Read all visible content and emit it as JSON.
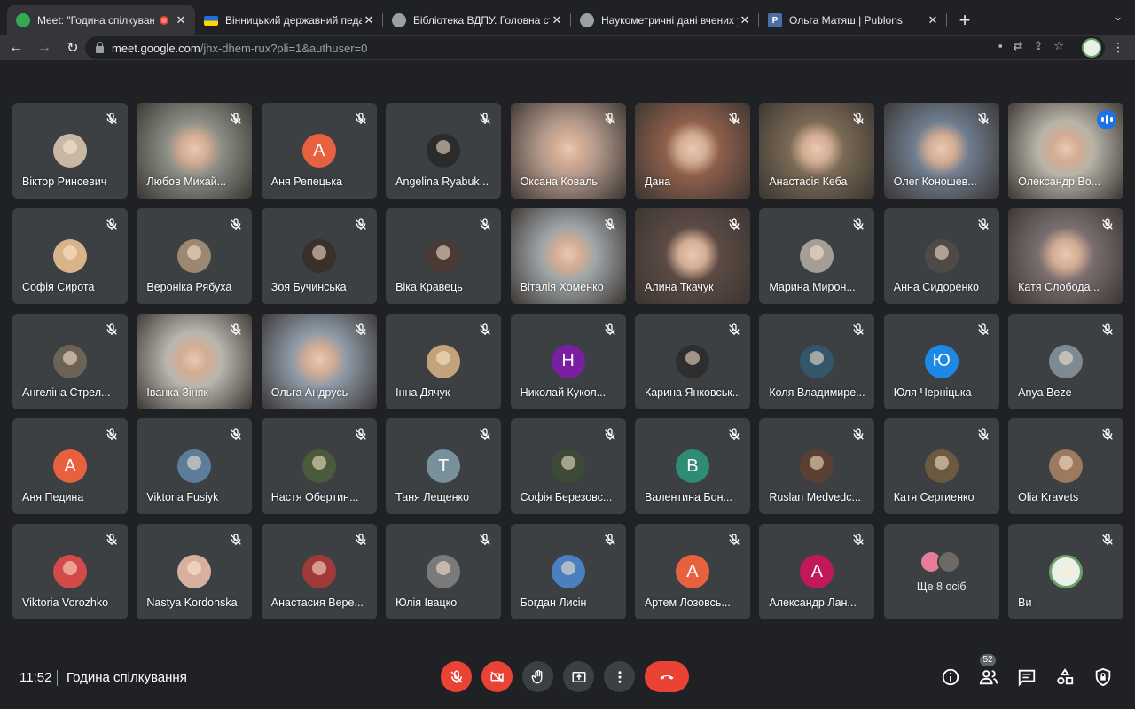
{
  "browser": {
    "tabs": [
      {
        "title": "Meet: \"Година спілкуванн",
        "favicon": "meet-icon",
        "fav_color": "#34a853",
        "recording": true,
        "active": true
      },
      {
        "title": "Вінницький державний педаг",
        "favicon": "ukraine-flag-icon",
        "fav_color": "#ffd500",
        "active": false
      },
      {
        "title": "Бібліотека ВДПУ. Головна сто",
        "favicon": "globe-icon",
        "fav_color": "#9aa0a6",
        "active": false
      },
      {
        "title": "Наукометричні дані вчених у",
        "favicon": "globe-icon",
        "fav_color": "#9aa0a6",
        "active": false
      },
      {
        "title": "Ольга Матяш | Publons",
        "favicon": "publons-icon",
        "fav_color": "#4a6fa5",
        "fav_letter": "P",
        "active": false
      }
    ],
    "url_host": "meet.google.com",
    "url_path": "/jhx-dhem-rux?pli=1&authuser=0"
  },
  "participants": [
    {
      "name": "Віктор Ринсевич",
      "type": "avatar_photo",
      "color": "#c9b7a6"
    },
    {
      "name": "Любов Михай...",
      "type": "video",
      "color": "#8c8f86"
    },
    {
      "name": "Аня Репецька",
      "type": "avatar_letter",
      "letter": "А",
      "color": "#e8613f"
    },
    {
      "name": "Angelina Ryabuk...",
      "type": "avatar_photo",
      "color": "#2b2b2b"
    },
    {
      "name": "Оксана Коваль",
      "type": "video",
      "color": "#b59a8c"
    },
    {
      "name": "Дана",
      "type": "video",
      "color": "#8e5f4b"
    },
    {
      "name": "Анастасія Кеба",
      "type": "video",
      "color": "#7a6a55"
    },
    {
      "name": "Олег Коношев...",
      "type": "video",
      "color": "#6f7d8f"
    },
    {
      "name": "Олександр Во...",
      "type": "video",
      "color": "#b8b4a8",
      "speaking": true
    },
    {
      "name": "Софія Сирота",
      "type": "avatar_photo",
      "color": "#d9b48b"
    },
    {
      "name": "Вероніка Рябуха",
      "type": "avatar_photo",
      "color": "#9b8872"
    },
    {
      "name": "Зоя Бучинська",
      "type": "avatar_photo",
      "color": "#3a2f2a"
    },
    {
      "name": "Віка Кравець",
      "type": "avatar_photo",
      "color": "#4a3a35"
    },
    {
      "name": "Віталія Хоменко",
      "type": "video",
      "color": "#9fa5a8"
    },
    {
      "name": "Алина Ткачук",
      "type": "video",
      "color": "#5c4a44"
    },
    {
      "name": "Марина Мирон...",
      "type": "avatar_photo",
      "color": "#a49e97"
    },
    {
      "name": "Анна Сидоренко",
      "type": "avatar_photo",
      "color": "#4f4a48"
    },
    {
      "name": "Катя Слобода...",
      "type": "video",
      "color": "#7a6e70"
    },
    {
      "name": "Ангеліна Стрел...",
      "type": "avatar_photo",
      "color": "#6d6257"
    },
    {
      "name": "Іванка Зіняк",
      "type": "video",
      "color": "#b9b6ae"
    },
    {
      "name": "Ольга Андрусь",
      "type": "video",
      "color": "#8e9aa8"
    },
    {
      "name": "Інна Дячук",
      "type": "avatar_photo",
      "color": "#c4a27c"
    },
    {
      "name": "Николай Кукол...",
      "type": "avatar_letter",
      "letter": "Н",
      "color": "#7b1fa2"
    },
    {
      "name": "Карина Янковськ...",
      "type": "avatar_photo",
      "color": "#2e2e2e"
    },
    {
      "name": "Коля Владимире...",
      "type": "avatar_photo",
      "color": "#33566b"
    },
    {
      "name": "Юля Черніцька",
      "type": "avatar_letter",
      "letter": "Ю",
      "color": "#1e88e5"
    },
    {
      "name": "Anya Beze",
      "type": "avatar_photo",
      "color": "#7d8a94"
    },
    {
      "name": "Аня Педина",
      "type": "avatar_letter",
      "letter": "А",
      "color": "#e8613f"
    },
    {
      "name": "Viktoria Fusiyk",
      "type": "avatar_photo",
      "color": "#5d7d9b"
    },
    {
      "name": "Настя Обертин...",
      "type": "avatar_photo",
      "color": "#4b5a3a"
    },
    {
      "name": "Таня Лещенко",
      "type": "avatar_letter",
      "letter": "Т",
      "color": "#78909c"
    },
    {
      "name": "Софія Березовс...",
      "type": "avatar_photo",
      "color": "#3d4a35"
    },
    {
      "name": "Валентина Бон...",
      "type": "avatar_letter",
      "letter": "В",
      "color": "#2e8b74"
    },
    {
      "name": "Ruslan Medvedc...",
      "type": "avatar_photo",
      "color": "#5a4030"
    },
    {
      "name": "Катя Сергиенко",
      "type": "avatar_photo",
      "color": "#6b5a40"
    },
    {
      "name": "Olia Kravets",
      "type": "avatar_photo",
      "color": "#9b7a5f"
    },
    {
      "name": "Viktoria Vorozhko",
      "type": "avatar_photo",
      "color": "#d24a4a"
    },
    {
      "name": "Nastya Kordonska",
      "type": "avatar_photo",
      "color": "#d9b0a0"
    },
    {
      "name": "Анастасия Вере...",
      "type": "avatar_photo",
      "color": "#a03a3a"
    },
    {
      "name": "Юлія Івацко",
      "type": "avatar_photo",
      "color": "#7a7a7a"
    },
    {
      "name": "Богдан Лисін",
      "type": "avatar_photo",
      "color": "#4a7fc0"
    },
    {
      "name": "Артем Лозовсь...",
      "type": "avatar_letter",
      "letter": "А",
      "color": "#e8613f"
    },
    {
      "name": "Александр Лан...",
      "type": "avatar_letter",
      "letter": "А",
      "color": "#c2185b"
    },
    {
      "name": "Ще 8 осіб",
      "type": "more"
    },
    {
      "name": "Ви",
      "type": "avatar_photo",
      "color": "#e8f0e8",
      "self": true
    }
  ],
  "more_colors": [
    "#e57c98",
    "#6d6a66"
  ],
  "bottom": {
    "time": "11:52",
    "meeting_title": "Година спілкування",
    "participant_count": "52"
  }
}
